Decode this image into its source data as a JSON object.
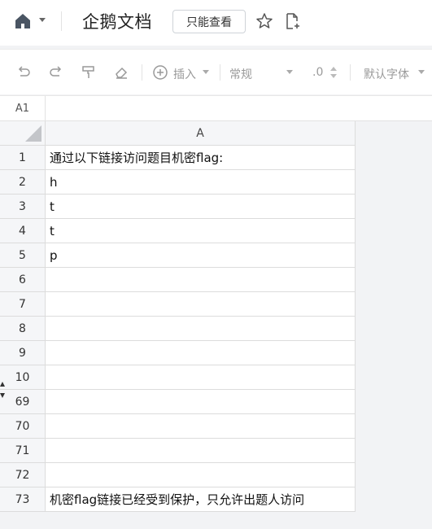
{
  "header": {
    "app_title": "企鹅文档",
    "readonly_label": "只能查看"
  },
  "toolbar": {
    "insert_label": "插入",
    "format_label": "常规",
    "decimal_label": ".0",
    "font_label": "默认字体"
  },
  "refbar": {
    "cell_ref": "A1"
  },
  "grid": {
    "column_header": "A",
    "rows": [
      {
        "num": "1",
        "value": "通过以下链接访问题目机密flag:"
      },
      {
        "num": "2",
        "value": "h"
      },
      {
        "num": "3",
        "value": "t"
      },
      {
        "num": "4",
        "value": "t"
      },
      {
        "num": "5",
        "value": "p"
      },
      {
        "num": "6",
        "value": ""
      },
      {
        "num": "7",
        "value": ""
      },
      {
        "num": "8",
        "value": ""
      },
      {
        "num": "9",
        "value": ""
      },
      {
        "num": "10",
        "value": ""
      },
      {
        "num": "69",
        "value": ""
      },
      {
        "num": "70",
        "value": ""
      },
      {
        "num": "71",
        "value": ""
      },
      {
        "num": "72",
        "value": ""
      },
      {
        "num": "73",
        "value": "机密flag链接已经受到保护，只允许出题人访问"
      }
    ]
  }
}
